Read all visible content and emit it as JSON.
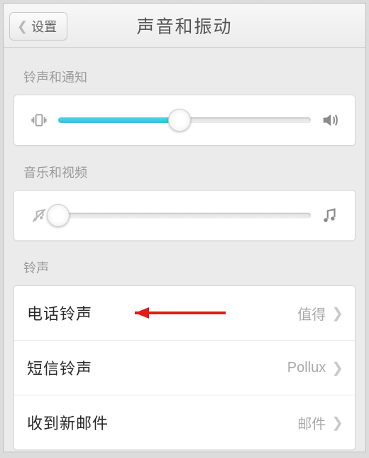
{
  "header": {
    "back_label": "设置",
    "title": "声音和振动"
  },
  "sections": {
    "ringtone_notification": {
      "label": "铃声和通知",
      "slider_percent": 48
    },
    "music_video": {
      "label": "音乐和视频",
      "slider_percent": 0
    },
    "ringtones": {
      "label": "铃声",
      "phone": {
        "label": "电话铃声",
        "value": "值得"
      },
      "sms": {
        "label": "短信铃声",
        "value": "Pollux"
      },
      "mail": {
        "label": "收到新邮件",
        "value": "邮件"
      }
    }
  },
  "colors": {
    "accent": "#35c3d6",
    "text_secondary": "#9b9b9b",
    "annotation": "#e21a1a"
  }
}
